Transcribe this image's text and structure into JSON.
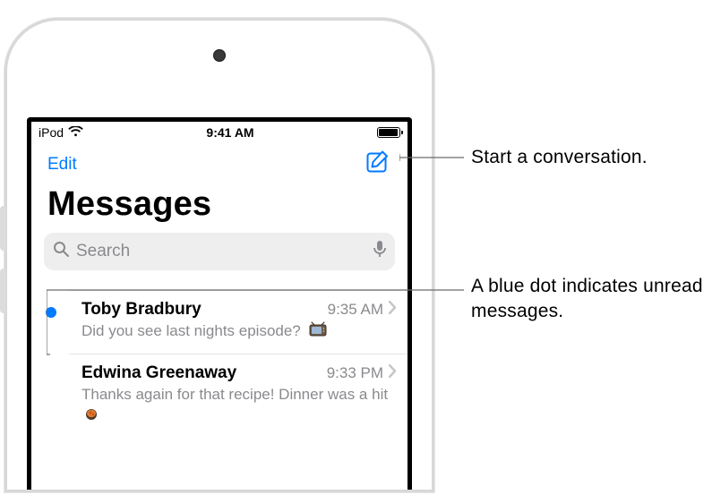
{
  "status": {
    "carrier": "iPod",
    "time": "9:41 AM"
  },
  "nav": {
    "edit": "Edit"
  },
  "title": "Messages",
  "search": {
    "placeholder": "Search"
  },
  "conversations": [
    {
      "unread": true,
      "name": "Toby Bradbury",
      "time": "9:35 AM",
      "preview": "Did you see last nights episode?"
    },
    {
      "unread": false,
      "name": "Edwina Greenaway",
      "time": "9:33 PM",
      "preview": "Thanks again for that recipe! Dinner was a hit"
    }
  ],
  "callouts": {
    "compose": "Start a conversation.",
    "unread": "A blue dot indicates unread messages."
  }
}
